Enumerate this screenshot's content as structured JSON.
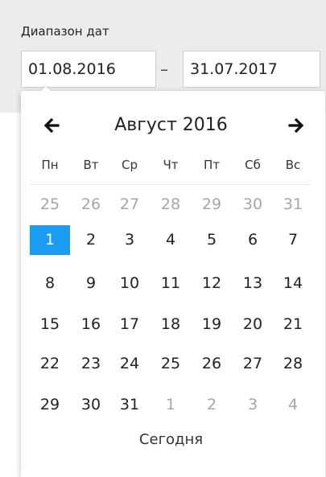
{
  "filter": {
    "label": "Диапазон дат",
    "from_value": "01.08.2016",
    "to_value": "31.07.2017",
    "separator": "–"
  },
  "calendar": {
    "month_title": "Август 2016",
    "prev_icon": "arrow-left-icon",
    "next_icon": "arrow-right-icon",
    "weekdays": [
      "Пн",
      "Вт",
      "Ср",
      "Чт",
      "Пт",
      "Сб",
      "Вс"
    ],
    "selected_day": "1",
    "weeks": [
      [
        {
          "d": "25",
          "m": true
        },
        {
          "d": "26",
          "m": true
        },
        {
          "d": "27",
          "m": true
        },
        {
          "d": "28",
          "m": true
        },
        {
          "d": "29",
          "m": true
        },
        {
          "d": "30",
          "m": true
        },
        {
          "d": "31",
          "m": true
        }
      ],
      [
        {
          "d": "1",
          "s": true
        },
        {
          "d": "2"
        },
        {
          "d": "3"
        },
        {
          "d": "4"
        },
        {
          "d": "5"
        },
        {
          "d": "6"
        },
        {
          "d": "7"
        }
      ],
      [
        {
          "d": "8"
        },
        {
          "d": "9"
        },
        {
          "d": "10"
        },
        {
          "d": "11"
        },
        {
          "d": "12"
        },
        {
          "d": "13"
        },
        {
          "d": "14"
        }
      ],
      [
        {
          "d": "15"
        },
        {
          "d": "16"
        },
        {
          "d": "17"
        },
        {
          "d": "18"
        },
        {
          "d": "19"
        },
        {
          "d": "20"
        },
        {
          "d": "21"
        }
      ],
      [
        {
          "d": "22"
        },
        {
          "d": "23"
        },
        {
          "d": "24"
        },
        {
          "d": "25"
        },
        {
          "d": "26"
        },
        {
          "d": "27"
        },
        {
          "d": "28"
        }
      ],
      [
        {
          "d": "29"
        },
        {
          "d": "30"
        },
        {
          "d": "31"
        },
        {
          "d": "1",
          "m": true
        },
        {
          "d": "2",
          "m": true
        },
        {
          "d": "3",
          "m": true
        },
        {
          "d": "4",
          "m": true
        }
      ]
    ],
    "today_label": "Сегодня",
    "selected_color": "#1a9cf2",
    "muted_color": "#a6a6a6"
  }
}
